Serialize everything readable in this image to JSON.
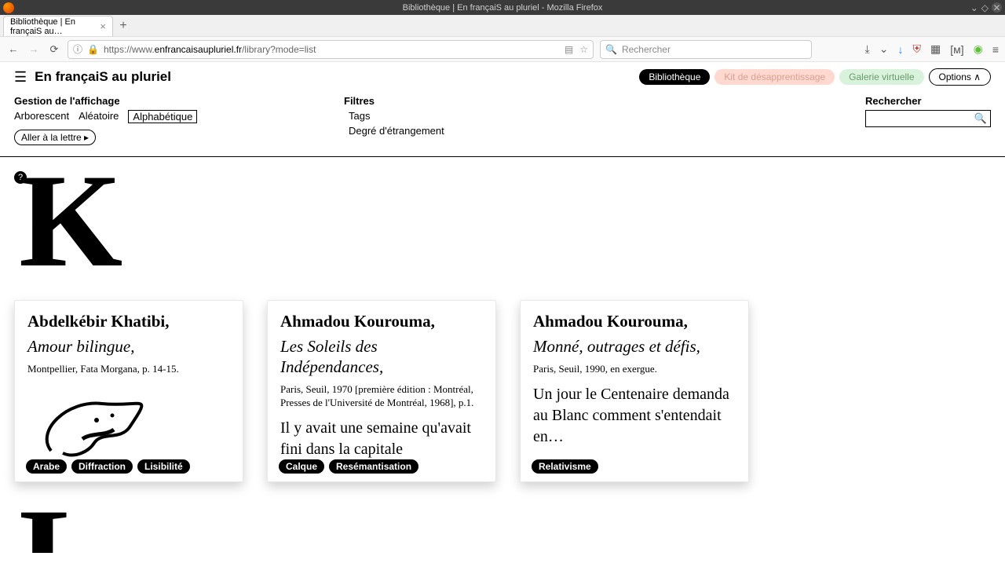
{
  "window": {
    "title": "Bibliothèque | En françaiS au pluriel - Mozilla Firefox"
  },
  "tab": {
    "label": "Bibliothèque | En françaiS au…"
  },
  "url": {
    "scheme": "https://www.",
    "host": "enfrancaisaupluriel.fr",
    "path": "/library?mode=list"
  },
  "browser_search": {
    "placeholder": "Rechercher"
  },
  "header": {
    "site_name": "En françaiS au pluriel",
    "pills": {
      "library": "Bibliothèque",
      "kit": "Kit de désapprentissage",
      "gallery": "Galerie virtuelle",
      "options": "Options ∧"
    }
  },
  "controls": {
    "display_label": "Gestion de l'affichage",
    "modes": {
      "arbo": "Arborescent",
      "random": "Aléatoire",
      "alpha": "Alphabétique"
    },
    "letter_btn": "Aller à la lettre ▸",
    "filters_label": "Filtres",
    "filters": {
      "tags": "Tags",
      "degree": "Degré d'étrangement"
    },
    "search_label": "Rechercher"
  },
  "section_letter": "K",
  "section_letter_next": "L",
  "help": "?",
  "cards": [
    {
      "author": "Abdelkébir Khatibi",
      "title": "Amour bilingue",
      "pub": "Montpellier, Fata Morgana, p. 14-15.",
      "tags": [
        "Arabe",
        "Diffraction",
        "Lisibilité"
      ]
    },
    {
      "author": "Ahmadou Kourouma",
      "title": "Les Soleils des Indépendances",
      "pub": "Paris, Seuil, 1970 [première édition : Montréal, Presses de l'Université de Montréal, 1968], p.1.",
      "excerpt": "Il y avait une semaine qu'avait fini dans la capitale",
      "tags": [
        "Calque",
        "Resémantisation"
      ]
    },
    {
      "author": "Ahmadou Kourouma",
      "title": "Monné, outrages et défis",
      "pub": "Paris, Seuil, 1990, en exergue.",
      "excerpt": "Un jour le Centenaire demanda au Blanc comment s'entendait en…",
      "tags": [
        "Relativisme"
      ]
    }
  ]
}
